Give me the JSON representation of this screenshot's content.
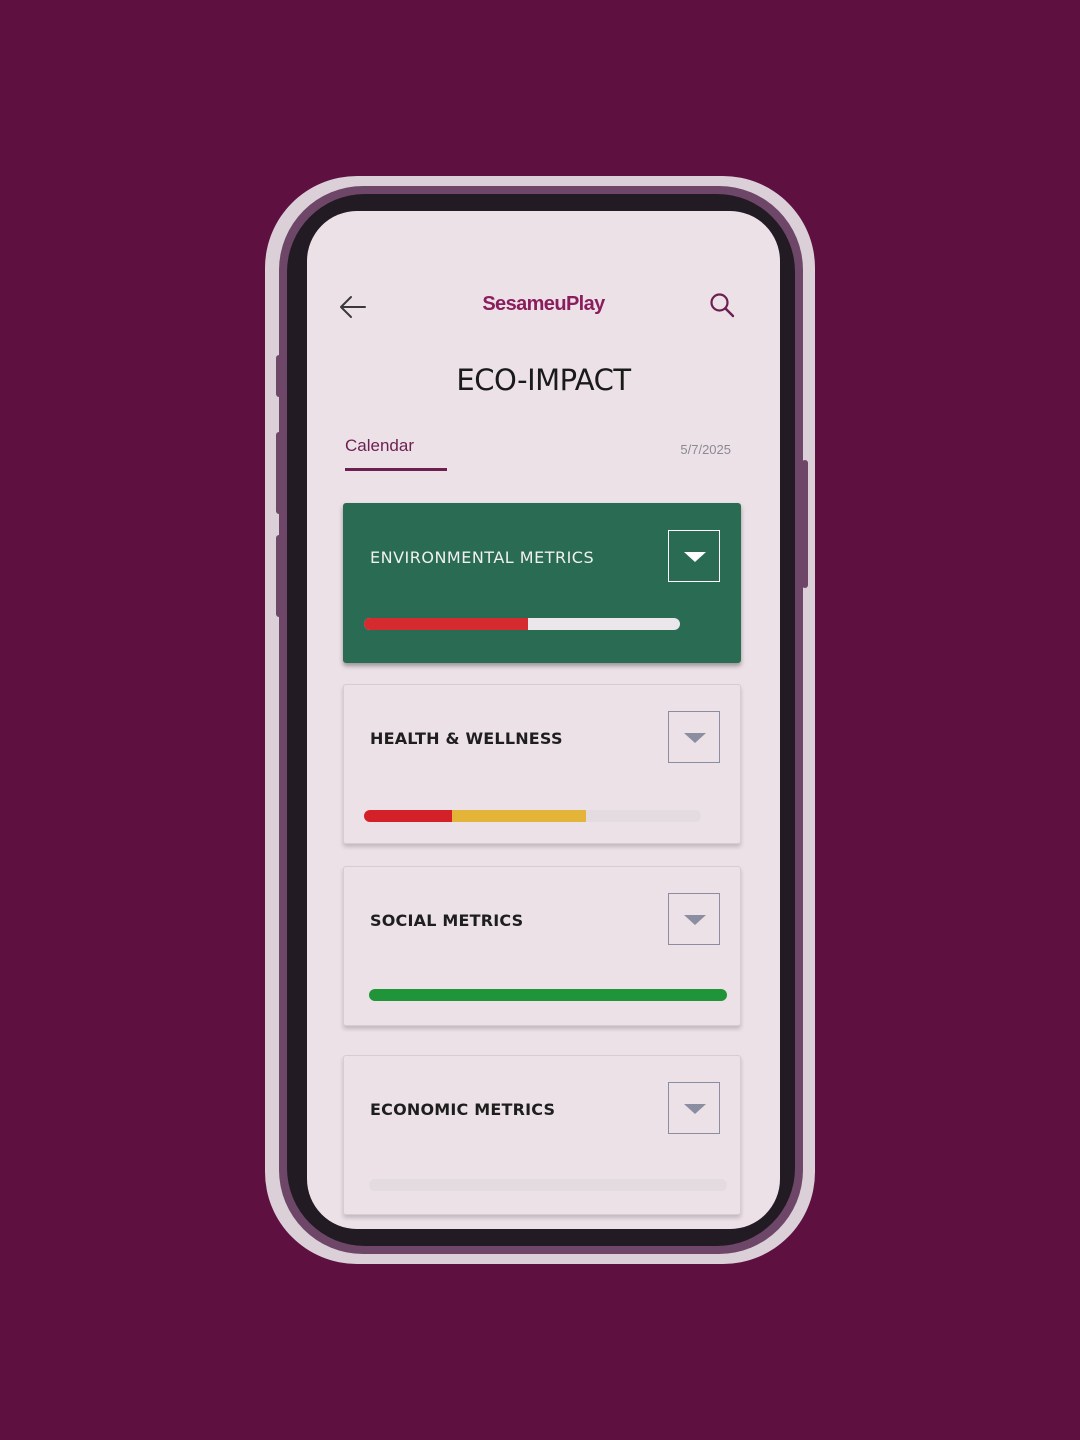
{
  "header": {
    "back_icon": "arrow-left-icon",
    "brand": "SesameuPlay",
    "search_icon": "search-icon"
  },
  "page": {
    "title": "ECO-IMPACT"
  },
  "tabs": {
    "active_label": "Calendar",
    "date": "5/7/2025"
  },
  "cards": [
    {
      "title": "ENVIRONMENTAL METRICS",
      "active": true,
      "progress": [
        {
          "color": "#d42a30",
          "fraction": 0.52
        }
      ]
    },
    {
      "title": "HEALTH & WELLNESS",
      "active": false,
      "progress": [
        {
          "color": "#d42028",
          "fraction": 0.26
        },
        {
          "color": "#e3b437",
          "fraction": 0.4
        }
      ]
    },
    {
      "title": "SOCIAL METRICS",
      "active": false,
      "progress": [
        {
          "color": "#1f9438",
          "fraction": 1.0
        }
      ]
    },
    {
      "title": "ECONOMIC METRICS",
      "active": false,
      "progress": []
    }
  ],
  "colors": {
    "background": "#5e1040",
    "screen": "#ece1e7",
    "brand": "#8b1d5d",
    "active_card": "#2a6b53"
  }
}
